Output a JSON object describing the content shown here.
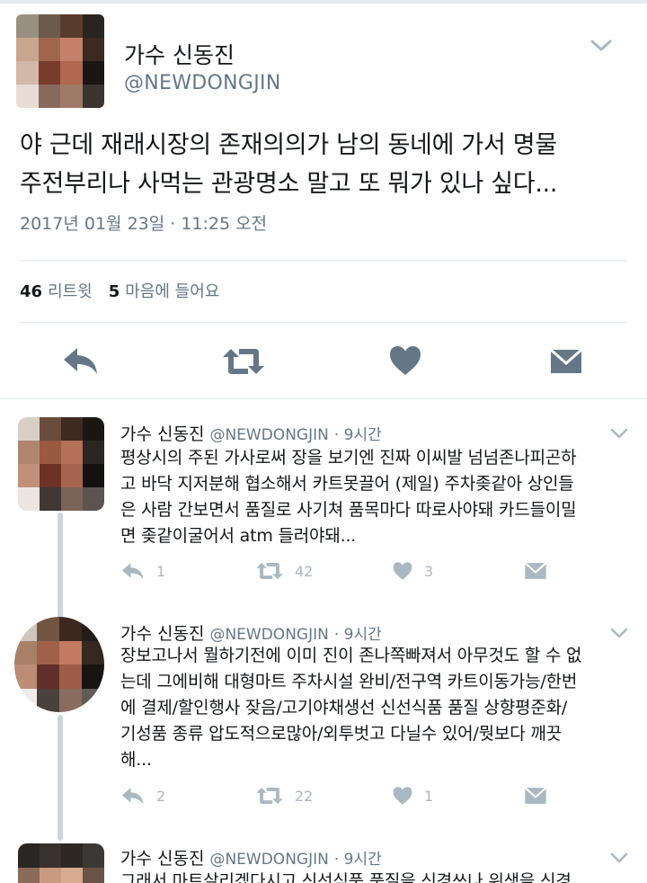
{
  "main_tweet": {
    "author_name": "가수 신동진",
    "handle": "@NEWDONGJIN",
    "text_line1": "야 근데 재래시장의 존재의의가 남의 동네에 가서 명물",
    "text_line2": "주전부리나 사먹는 관광명소 말고 또 뭐가 있나 싶다...",
    "date": "2017년 01월 23일 · 11:25 오전",
    "retweet_count": "46",
    "retweet_label": "리트윗",
    "like_count": "5",
    "like_label": "마음에 들어요"
  },
  "replies": [
    {
      "author_name": "가수 신동진",
      "handle": "@NEWDONGJIN",
      "time": "· 9시간",
      "lines": [
        "평상시의 주된 가사로써 장을 보기엔 진짜 이씨발 넘넘존나피곤하",
        "고 바닥 지저분해 협소해서 카트못끌어 (제일) 주차좆같아 상인들",
        "은 사람 간보면서 품질로 사기쳐 품목마다 따로사야돼 카드들이밀",
        "면 좆같이굴어서 atm 들러야돼..."
      ],
      "reply_count": "1",
      "retweet_count": "42",
      "like_count": "3"
    },
    {
      "author_name": "가수 신동진",
      "handle": "@NEWDONGJIN",
      "time": "· 9시간",
      "lines": [
        "장보고나서 뭘하기전에 이미 진이 존나쪽빠져서 아무것도 할 수 없",
        "는데 그에비해 대형마트 주차시설 완비/전구역 카트이동가능/한번",
        "에 결제/할인행사 잦음/고기야채생선 신선식품 품질 상향평준화/",
        "기성품 종류 압도적으로많아/외투벗고 다닐수 있어/뭣보다 깨끗",
        "해..."
      ],
      "reply_count": "2",
      "retweet_count": "22",
      "like_count": "1"
    },
    {
      "author_name": "가수 신동진",
      "handle": "@NEWDONGJIN",
      "time": "· 9시간",
      "lines": [
        "그래서 마트살리겠다시고 신선식품 품질을 신경쓰나 위생을 신경"
      ]
    }
  ],
  "icons": {
    "reply": "reply-arrow-icon",
    "retweet": "retweet-icon",
    "like": "heart-icon",
    "dm": "envelope-icon",
    "menu": "chevron-down-icon"
  },
  "colors": {
    "text_primary": "#14171a",
    "text_secondary": "#657786",
    "action_icon_main": "#657786",
    "action_icon_reply": "#aab8c2",
    "divider": "#e1e8ed"
  }
}
